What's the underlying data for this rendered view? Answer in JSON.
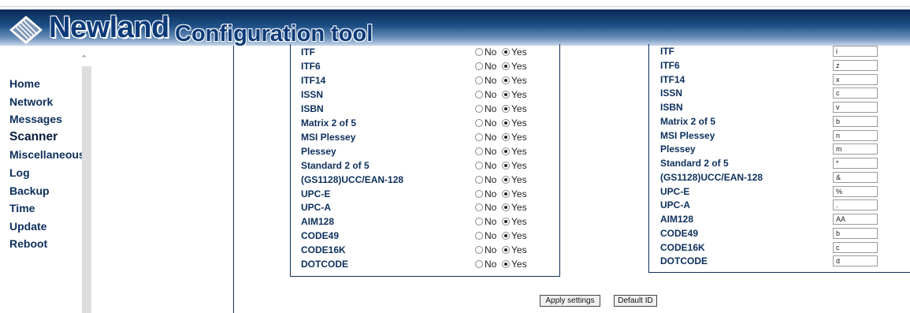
{
  "header": {
    "brand": "Newland",
    "subtitle": "Configuration tool"
  },
  "nav": {
    "items": [
      {
        "label": "Home",
        "active": false
      },
      {
        "label": "Network",
        "active": false
      },
      {
        "label": "Messages",
        "active": false
      },
      {
        "label": "Scanner",
        "active": true
      },
      {
        "label": "Miscellaneous",
        "active": false
      },
      {
        "label": "Log",
        "active": false
      },
      {
        "label": "Backup",
        "active": false
      },
      {
        "label": "Time",
        "active": false
      },
      {
        "label": "Update",
        "active": false
      },
      {
        "label": "Reboot",
        "active": false
      }
    ]
  },
  "symbology_enable": {
    "no_label": "No",
    "yes_label": "Yes",
    "rows": [
      {
        "label": "ITF",
        "value": "Yes"
      },
      {
        "label": "ITF6",
        "value": "Yes"
      },
      {
        "label": "ITF14",
        "value": "Yes"
      },
      {
        "label": "ISSN",
        "value": "Yes"
      },
      {
        "label": "ISBN",
        "value": "Yes"
      },
      {
        "label": "Matrix 2 of 5",
        "value": "Yes"
      },
      {
        "label": "MSI Plessey",
        "value": "Yes"
      },
      {
        "label": "Plessey",
        "value": "Yes"
      },
      {
        "label": "Standard 2 of 5",
        "value": "Yes"
      },
      {
        "label": "(GS1128)UCC/EAN-128",
        "value": "Yes"
      },
      {
        "label": "UPC-E",
        "value": "Yes"
      },
      {
        "label": "UPC-A",
        "value": "Yes"
      },
      {
        "label": "AIM128",
        "value": "Yes"
      },
      {
        "label": "CODE49",
        "value": "Yes"
      },
      {
        "label": "CODE16K",
        "value": "Yes"
      },
      {
        "label": "DOTCODE",
        "value": "Yes"
      }
    ]
  },
  "symbology_id": {
    "rows": [
      {
        "label": "ITF",
        "value": "i"
      },
      {
        "label": "ITF6",
        "value": "z"
      },
      {
        "label": "ITF14",
        "value": "x"
      },
      {
        "label": "ISSN",
        "value": "c"
      },
      {
        "label": "ISBN",
        "value": "v"
      },
      {
        "label": "Matrix 2 of 5",
        "value": "b"
      },
      {
        "label": "MSI Plessey",
        "value": "n"
      },
      {
        "label": "Plessey",
        "value": "m"
      },
      {
        "label": "Standard 2 of 5",
        "value": "*"
      },
      {
        "label": "(GS1128)UCC/EAN-128",
        "value": "&"
      },
      {
        "label": "UPC-E",
        "value": "%"
      },
      {
        "label": "UPC-A",
        "value": "."
      },
      {
        "label": "AIM128",
        "value": "AA"
      },
      {
        "label": "CODE49",
        "value": "b"
      },
      {
        "label": "CODE16K",
        "value": "c"
      },
      {
        "label": "DOTCODE",
        "value": "d"
      }
    ]
  },
  "actions": {
    "apply_label": "Apply settings",
    "default_label": "Default ID"
  }
}
